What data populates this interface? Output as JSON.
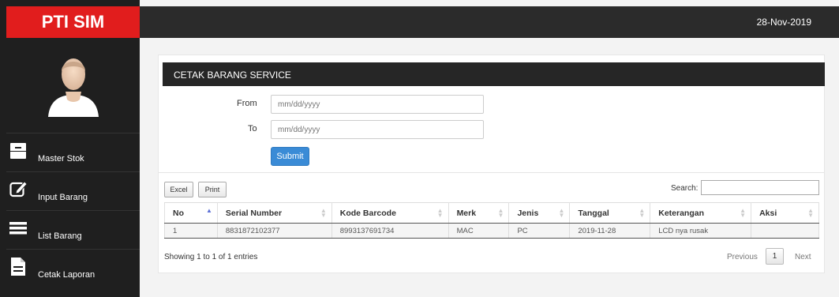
{
  "brand": "PTI SIM",
  "header": {
    "date": "28-Nov-2019"
  },
  "sidebar": {
    "items": [
      {
        "label": "Master Stok",
        "icon": "archive-box-icon"
      },
      {
        "label": "Input Barang",
        "icon": "edit-icon"
      },
      {
        "label": "List Barang",
        "icon": "list-icon"
      },
      {
        "label": "Cetak Laporan",
        "icon": "document-icon"
      }
    ]
  },
  "panel": {
    "title": "CETAK BARANG SERVICE",
    "from_label": "From",
    "from_placeholder": "mm/dd/yyyy",
    "to_label": "To",
    "to_placeholder": "mm/dd/yyyy",
    "submit_label": "Submit"
  },
  "table": {
    "buttons": {
      "excel": "Excel",
      "print": "Print"
    },
    "search_label": "Search:",
    "columns": [
      "No",
      "Serial Number",
      "Kode Barcode",
      "Merk",
      "Jenis",
      "Tanggal",
      "Keterangan",
      "Aksi"
    ],
    "rows": [
      [
        "1",
        "8831872102377",
        "8993137691734",
        "MAC",
        "PC",
        "2019-11-28",
        "LCD nya rusak",
        ""
      ]
    ],
    "info": "Showing 1 to 1 of 1 entries",
    "pagination": {
      "previous": "Previous",
      "page": "1",
      "next": "Next"
    }
  },
  "colors": {
    "brand": "#e11d1d",
    "sidebar": "#1f1f1f",
    "topbar": "#2b2b2b",
    "submit": "#3a8bd6"
  }
}
